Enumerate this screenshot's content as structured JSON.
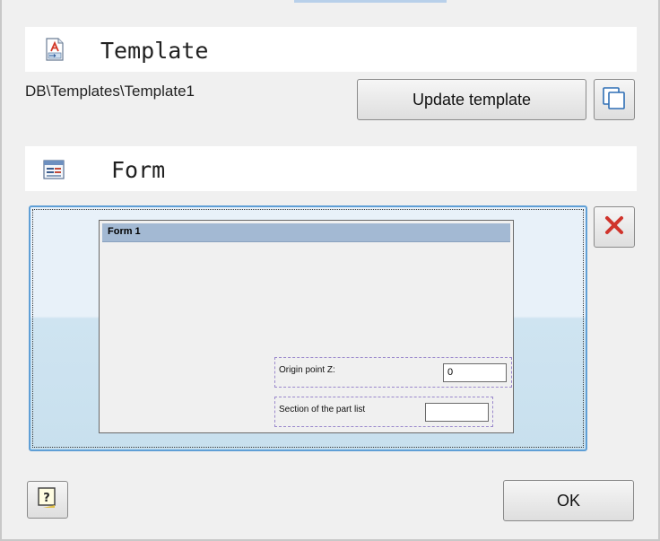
{
  "template_section": {
    "title": "Template",
    "icon": "template-icon",
    "path": "DB\\Templates\\Template1",
    "update_button_label": "Update template",
    "copy_icon": "copy-icon"
  },
  "form_section": {
    "title": "Form",
    "icon": "form-icon",
    "delete_icon": "delete-icon",
    "preview": {
      "title": "Form 1",
      "fields": [
        {
          "label": "Origin point Z:",
          "value": "0"
        },
        {
          "label": "Section of the part list",
          "value": ""
        }
      ]
    }
  },
  "footer": {
    "help_icon": "help-icon",
    "ok_label": "OK"
  }
}
